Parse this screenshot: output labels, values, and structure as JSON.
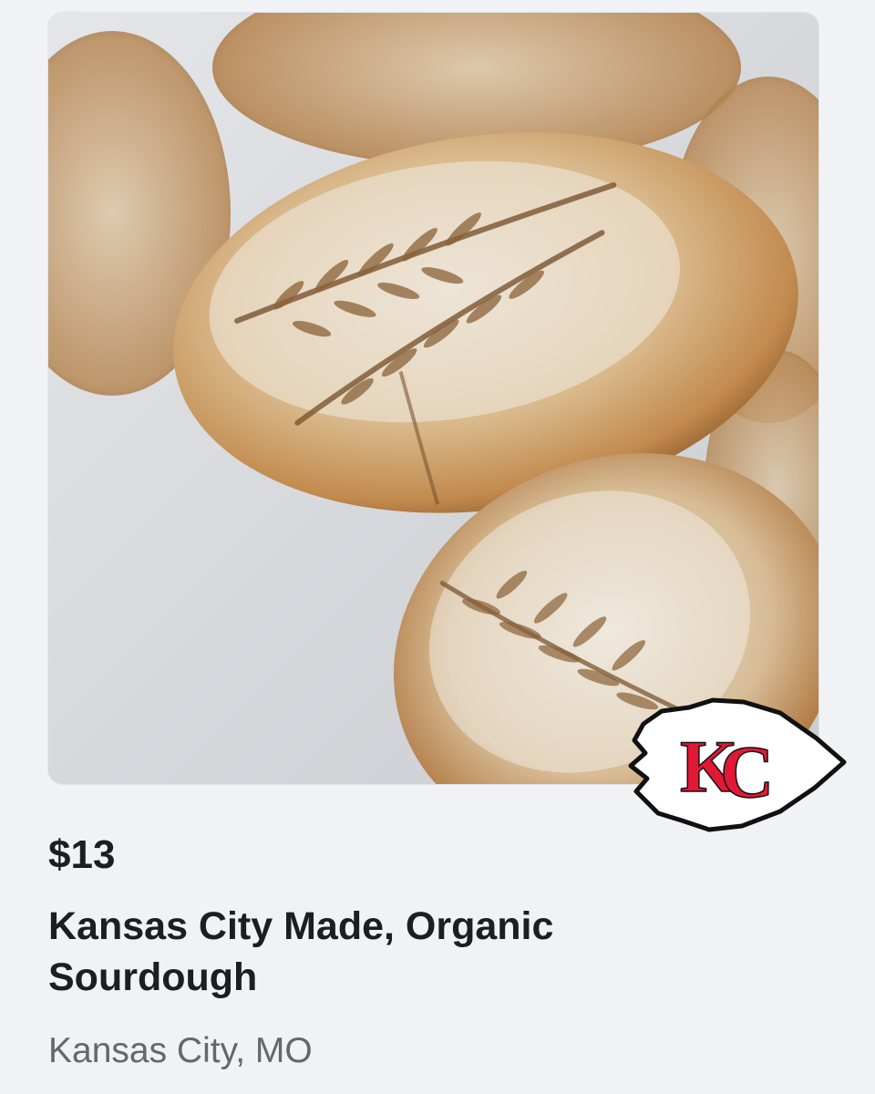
{
  "listing": {
    "price": "$13",
    "title": "Kansas City Made, Organic Sourdough",
    "location": "Kansas City, MO"
  },
  "logo": {
    "letters": "KC",
    "icon": "arrowhead-logo",
    "colors": {
      "red": "#e31837",
      "white": "#ffffff",
      "outline": "#111111"
    }
  },
  "colors": {
    "background": "#f0f2f5",
    "text_primary": "#1c1e21",
    "text_secondary": "#65676b"
  }
}
